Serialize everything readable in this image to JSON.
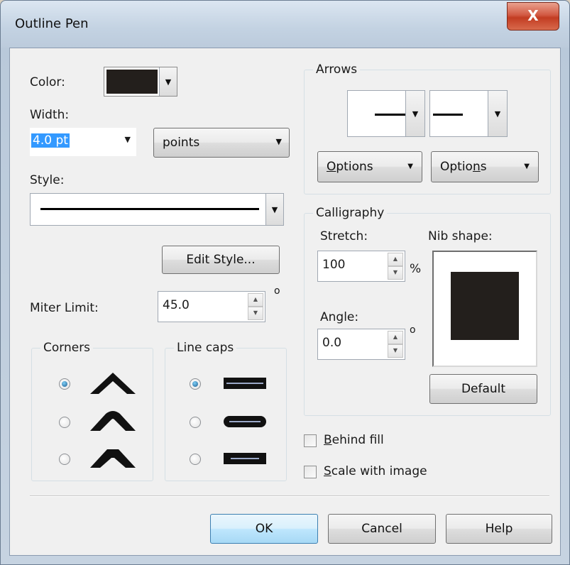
{
  "window": {
    "title": "Outline Pen",
    "close_glyph": "X"
  },
  "color": {
    "label": "Color:",
    "swatch": "#231f1c"
  },
  "width": {
    "label": "Width:",
    "value": "4.0 pt",
    "unit": "points"
  },
  "style": {
    "label": "Style:",
    "edit_button": "Edit Style..."
  },
  "miter": {
    "label": "Miter Limit:",
    "value": "45.0",
    "unit": "o"
  },
  "corners": {
    "title": "Corners",
    "selected_index": 0
  },
  "line_caps": {
    "title": "Line caps",
    "selected_index": 0
  },
  "arrows": {
    "title": "Arrows",
    "options_left": {
      "pre": "",
      "u": "O",
      "post": "ptions"
    },
    "options_right": {
      "pre": "Optio",
      "u": "n",
      "post": "s"
    }
  },
  "calligraphy": {
    "title": "Calligraphy",
    "stretch_label": "Stretch:",
    "stretch_value": "100",
    "stretch_unit": "%",
    "angle_label": "Angle:",
    "angle_value": "0.0",
    "angle_unit": "o",
    "nib_label": "Nib shape:",
    "default_button": "Default"
  },
  "checkboxes": {
    "behind_fill": {
      "u": "B",
      "rest": "ehind fill",
      "checked": false
    },
    "scale_with_image": {
      "u": "S",
      "rest": "cale with image",
      "checked": false
    }
  },
  "buttons": {
    "ok": "OK",
    "cancel": "Cancel",
    "help": "Help"
  },
  "icons": {
    "dropdown": "chevron-down-icon",
    "spin_up": "up-triangle-icon",
    "spin_down": "down-triangle-icon"
  }
}
